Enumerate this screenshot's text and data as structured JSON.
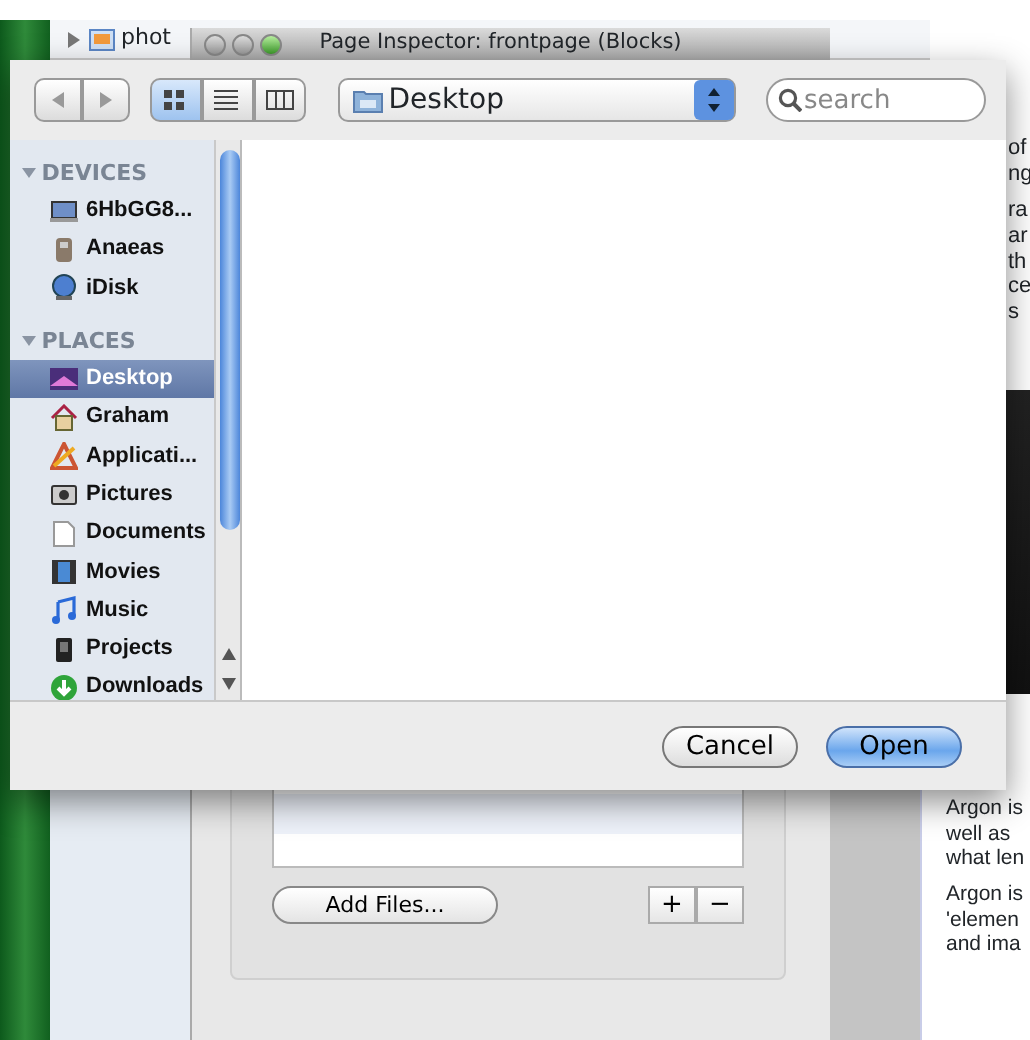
{
  "back_window": {
    "row_label": "phot"
  },
  "inspector": {
    "title": "Page Inspector: frontpage (Blocks)",
    "add_files": "Add Files...",
    "plus": "+",
    "minus": "−"
  },
  "web_page": {
    "paragraphs_top": [
      [
        "of",
        "ng"
      ],
      [
        "ra",
        "ar",
        "th",
        "ce",
        "s"
      ]
    ],
    "paragraphs_bottom": [
      [
        "Argon is",
        "well as",
        "what len"
      ],
      [
        "Argon is",
        "'elemen",
        "and ima"
      ]
    ]
  },
  "dialog": {
    "view_buttons": [
      {
        "kind": "icons",
        "selected": true
      },
      {
        "kind": "list",
        "selected": false
      },
      {
        "kind": "columns",
        "selected": false
      }
    ],
    "location": "Desktop",
    "search": {
      "placeholder": "search"
    },
    "sidebar": [
      {
        "heading": "DEVICES",
        "expanded": true,
        "items": [
          {
            "label": "6HbGG8...",
            "kind": "computer",
            "selected": false
          },
          {
            "label": "Anaeas",
            "kind": "disk",
            "selected": false
          },
          {
            "label": "iDisk",
            "kind": "idisk",
            "selected": false
          }
        ]
      },
      {
        "heading": "PLACES",
        "expanded": true,
        "items": [
          {
            "label": "Desktop",
            "kind": "desktop",
            "selected": true
          },
          {
            "label": "Graham",
            "kind": "home",
            "selected": false
          },
          {
            "label": "Applicati...",
            "kind": "apps",
            "selected": false
          },
          {
            "label": "Pictures",
            "kind": "pictures",
            "selected": false
          },
          {
            "label": "Documents",
            "kind": "documents",
            "selected": false
          },
          {
            "label": "Movies",
            "kind": "movies",
            "selected": false
          },
          {
            "label": "Music",
            "kind": "music",
            "selected": false
          },
          {
            "label": "Projects",
            "kind": "projects",
            "selected": false
          },
          {
            "label": "Downloads",
            "kind": "downloads",
            "selected": false
          }
        ]
      }
    ],
    "buttons": [
      {
        "label": "Cancel",
        "default": false
      },
      {
        "label": "Open",
        "default": true
      }
    ]
  }
}
